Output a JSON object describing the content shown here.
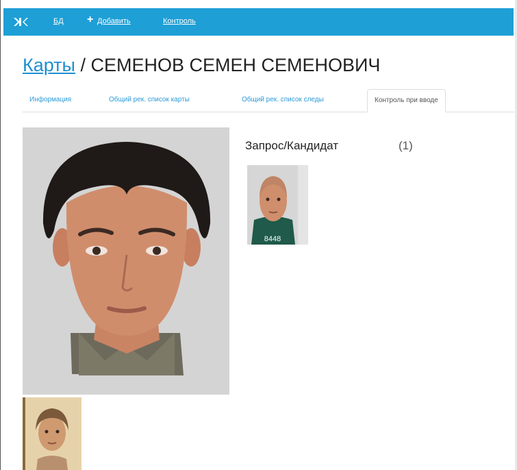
{
  "nav": {
    "logo_icon": "xk-logo",
    "links": [
      "БД",
      "Добавить",
      "Контроль"
    ],
    "add_icon": "plus-icon",
    "accent": "#1e9fd6"
  },
  "heading": {
    "crumb": "Карты",
    "separator": " / ",
    "title": "СЕМЕНОВ СЕМЕН СЕМЕНОВИЧ"
  },
  "tabs": [
    "Информация",
    "Общий рек. список карты",
    "Общий рек. список следы",
    "Контроль при вводе"
  ],
  "active_tab": "Контроль при вводе",
  "section": {
    "title": "Запрос/Кандидат",
    "count": "(1)"
  },
  "candidates": [
    {
      "id": "8448"
    }
  ]
}
